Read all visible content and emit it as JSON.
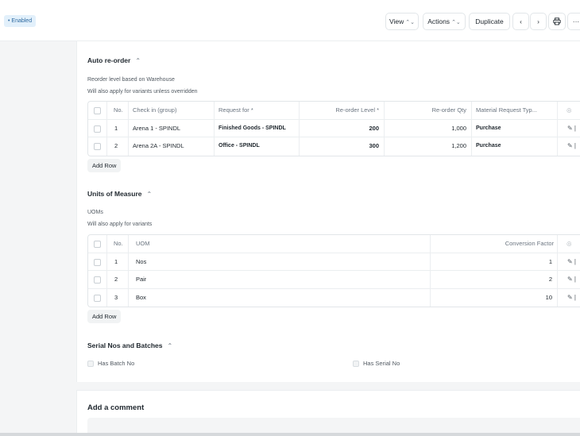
{
  "header": {
    "status_badge": "• Enabled",
    "view_label": "View",
    "actions_label": "Actions",
    "duplicate_label": "Duplicate",
    "more_label": "···"
  },
  "auto_reorder": {
    "title": "Auto re-order",
    "subtitle": "Reorder level based on Warehouse",
    "note": "Will also apply for variants unless overridden",
    "columns": {
      "no": "No.",
      "check_in": "Check in (group)",
      "request_for": "Request for *",
      "reorder_level": "Re-order Level *",
      "reorder_qty": "Re-order Qty",
      "material_request_type": "Material Request Typ..."
    },
    "rows": [
      {
        "no": "1",
        "check_in": "Arena 1 - SPINDL",
        "request_for": "Finished Goods - SPINDL",
        "reorder_level": "200",
        "reorder_qty": "1,000",
        "material_request_type": "Purchase"
      },
      {
        "no": "2",
        "check_in": "Arena 2A - SPINDL",
        "request_for": "Office - SPINDL",
        "reorder_level": "300",
        "reorder_qty": "1,200",
        "material_request_type": "Purchase"
      }
    ],
    "add_row": "Add Row"
  },
  "uoms": {
    "title": "Units of Measure",
    "subtitle": "UOMs",
    "note": "Will also apply for variants",
    "columns": {
      "no": "No.",
      "uom": "UOM",
      "conversion_factor": "Conversion Factor"
    },
    "rows": [
      {
        "no": "1",
        "uom": "Nos",
        "conversion_factor": "1"
      },
      {
        "no": "2",
        "uom": "Pair",
        "conversion_factor": "2"
      },
      {
        "no": "3",
        "uom": "Box",
        "conversion_factor": "10"
      }
    ],
    "add_row": "Add Row"
  },
  "serial": {
    "title": "Serial Nos and Batches",
    "has_batch_no": "Has Batch No",
    "has_serial_no": "Has Serial No"
  },
  "comment": {
    "title": "Add a comment"
  },
  "icons": {
    "caret": "chevron-up-icon",
    "edit": "pencil-icon"
  }
}
